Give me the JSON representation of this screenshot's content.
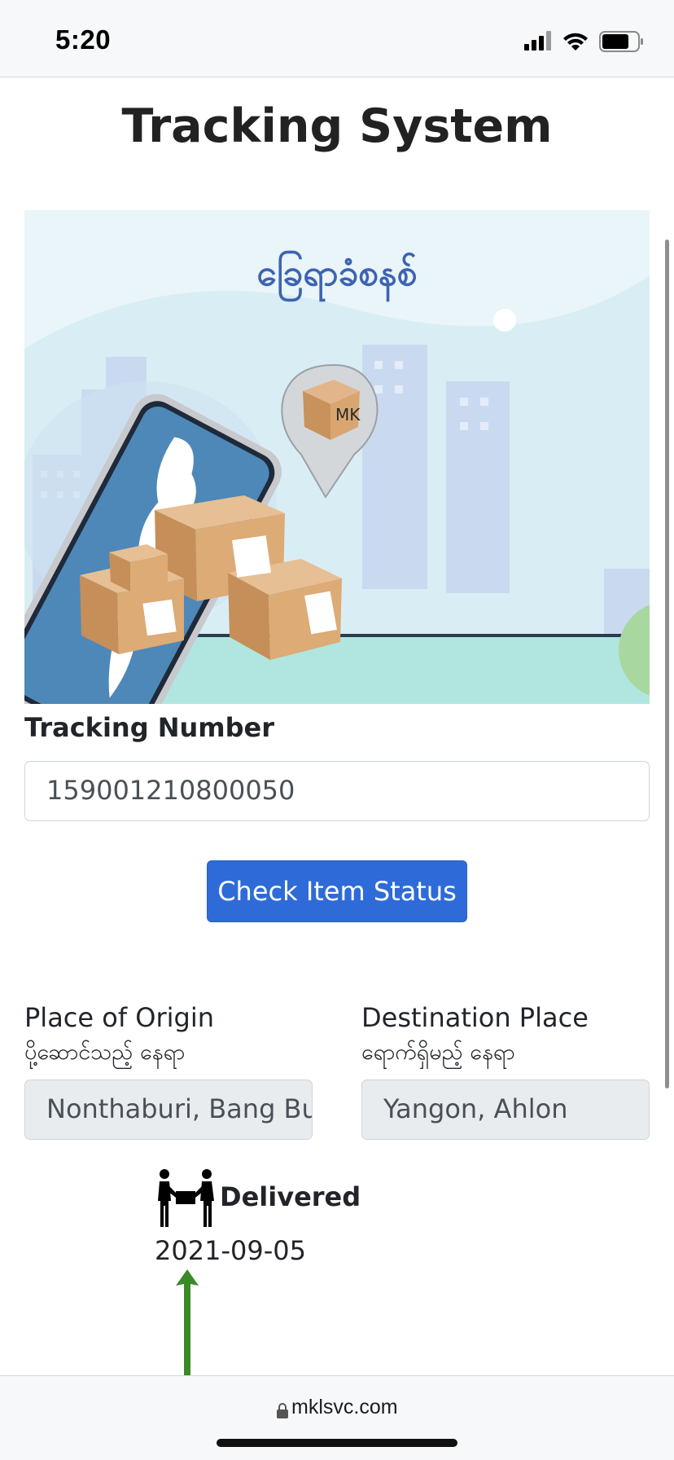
{
  "status_bar": {
    "time": "5:20"
  },
  "page": {
    "title": "Tracking System",
    "banner": {
      "headline": "ခြေရာခံစနစ်",
      "box_logo": "MK"
    },
    "tracking": {
      "label": "Tracking Number",
      "value": "159001210800050"
    },
    "check_button": "Check Item Status",
    "origin": {
      "label": "Place of Origin",
      "sublabel": "ပို့ဆောင်သည့် နေရာ",
      "value": "Nonthaburi, Bang Bu"
    },
    "destination": {
      "label": "Destination Place",
      "sublabel": "ရောက်ရှိမည့် နေရာ",
      "value": "Yangon, Ahlon"
    },
    "timeline": {
      "status": "Delivered",
      "date": "2021-09-05",
      "icon": "delivery-people-icon",
      "arrow_color": "#3a8a27"
    }
  },
  "browser": {
    "url": "mklsvc.com"
  },
  "colors": {
    "primary": "#2f6bd8",
    "banner_text": "#3e63b2"
  }
}
